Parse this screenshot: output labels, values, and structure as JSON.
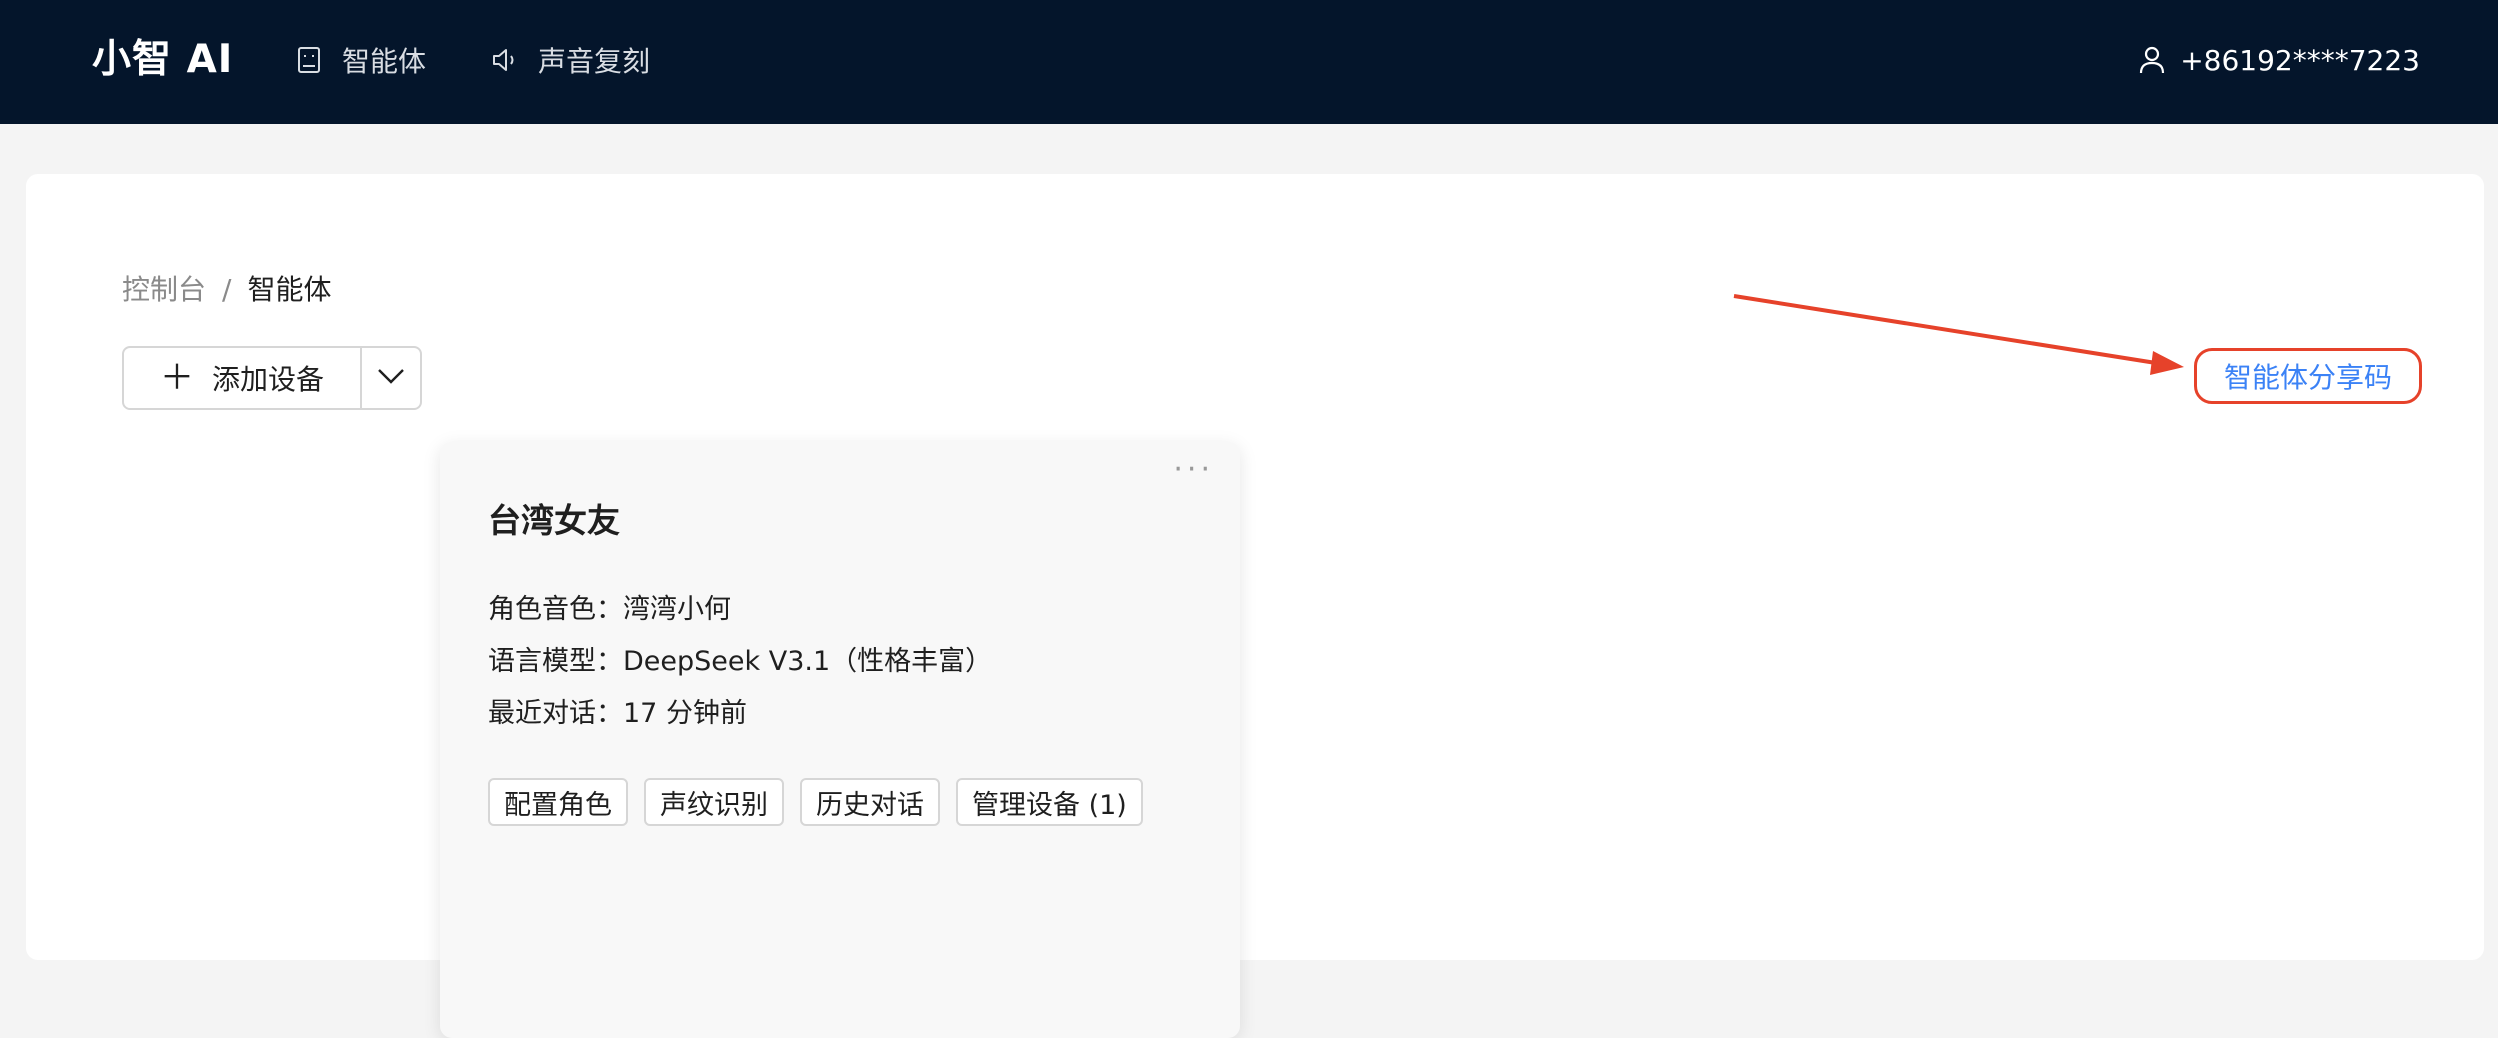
{
  "app": {
    "brand": "小智 AI"
  },
  "nav": {
    "items": [
      {
        "label": "智能体",
        "icon": "robot-icon"
      },
      {
        "label": "声音复刻",
        "icon": "speaker-icon"
      }
    ],
    "user": {
      "phone": "+86192****7223",
      "icon": "user-icon"
    }
  },
  "breadcrumb": {
    "root": "控制台",
    "separator": "/",
    "current": "智能体"
  },
  "toolbar": {
    "add_device_label": "添加设备",
    "add_device_icon": "plus-icon",
    "dropdown_icon": "chevron-down-icon",
    "share_code_label": "智能体分享码"
  },
  "annotation": {
    "color": "#e6422a"
  },
  "agent_card": {
    "title": "台湾女友",
    "more_icon": "ellipsis-icon",
    "voice": {
      "label": "角色音色：",
      "value": "湾湾小何"
    },
    "model": {
      "label": "语言模型：",
      "value": "DeepSeek V3.1（性格丰富）"
    },
    "last_chat": {
      "label": "最近对话：",
      "value": "17 分钟前"
    },
    "actions": [
      "配置角色",
      "声纹识别",
      "历史对话",
      "管理设备 (1)"
    ]
  },
  "colors": {
    "topbar_bg": "#04152b",
    "link": "#3b82f6",
    "highlight": "#e6422a"
  }
}
